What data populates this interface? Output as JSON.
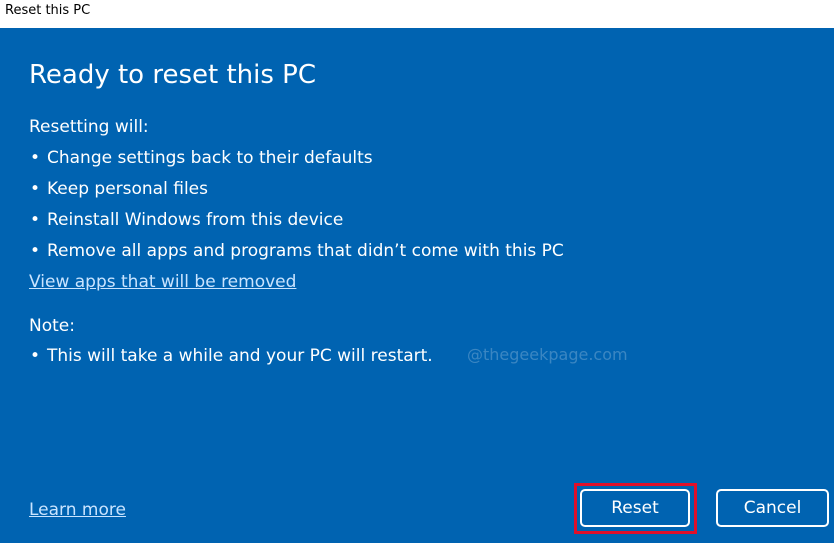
{
  "window": {
    "title": "Reset this PC"
  },
  "dialog": {
    "heading": "Ready to reset this PC",
    "resetting_label": "Resetting will:",
    "resetting_items": [
      "Change settings back to their defaults",
      "Keep personal files",
      "Reinstall Windows from this device",
      "Remove all apps and programs that didn’t come with this PC"
    ],
    "view_apps_link": "View apps that will be removed",
    "note_label": "Note:",
    "note_items": [
      "This will take a while and your PC will restart."
    ],
    "watermark": "@thegeekpage.com",
    "learn_more_link": "Learn more",
    "reset_button": "Reset",
    "cancel_button": "Cancel"
  },
  "colors": {
    "dialog_background": "#0063b1",
    "highlight_border": "#e0102a",
    "text": "#ffffff"
  }
}
